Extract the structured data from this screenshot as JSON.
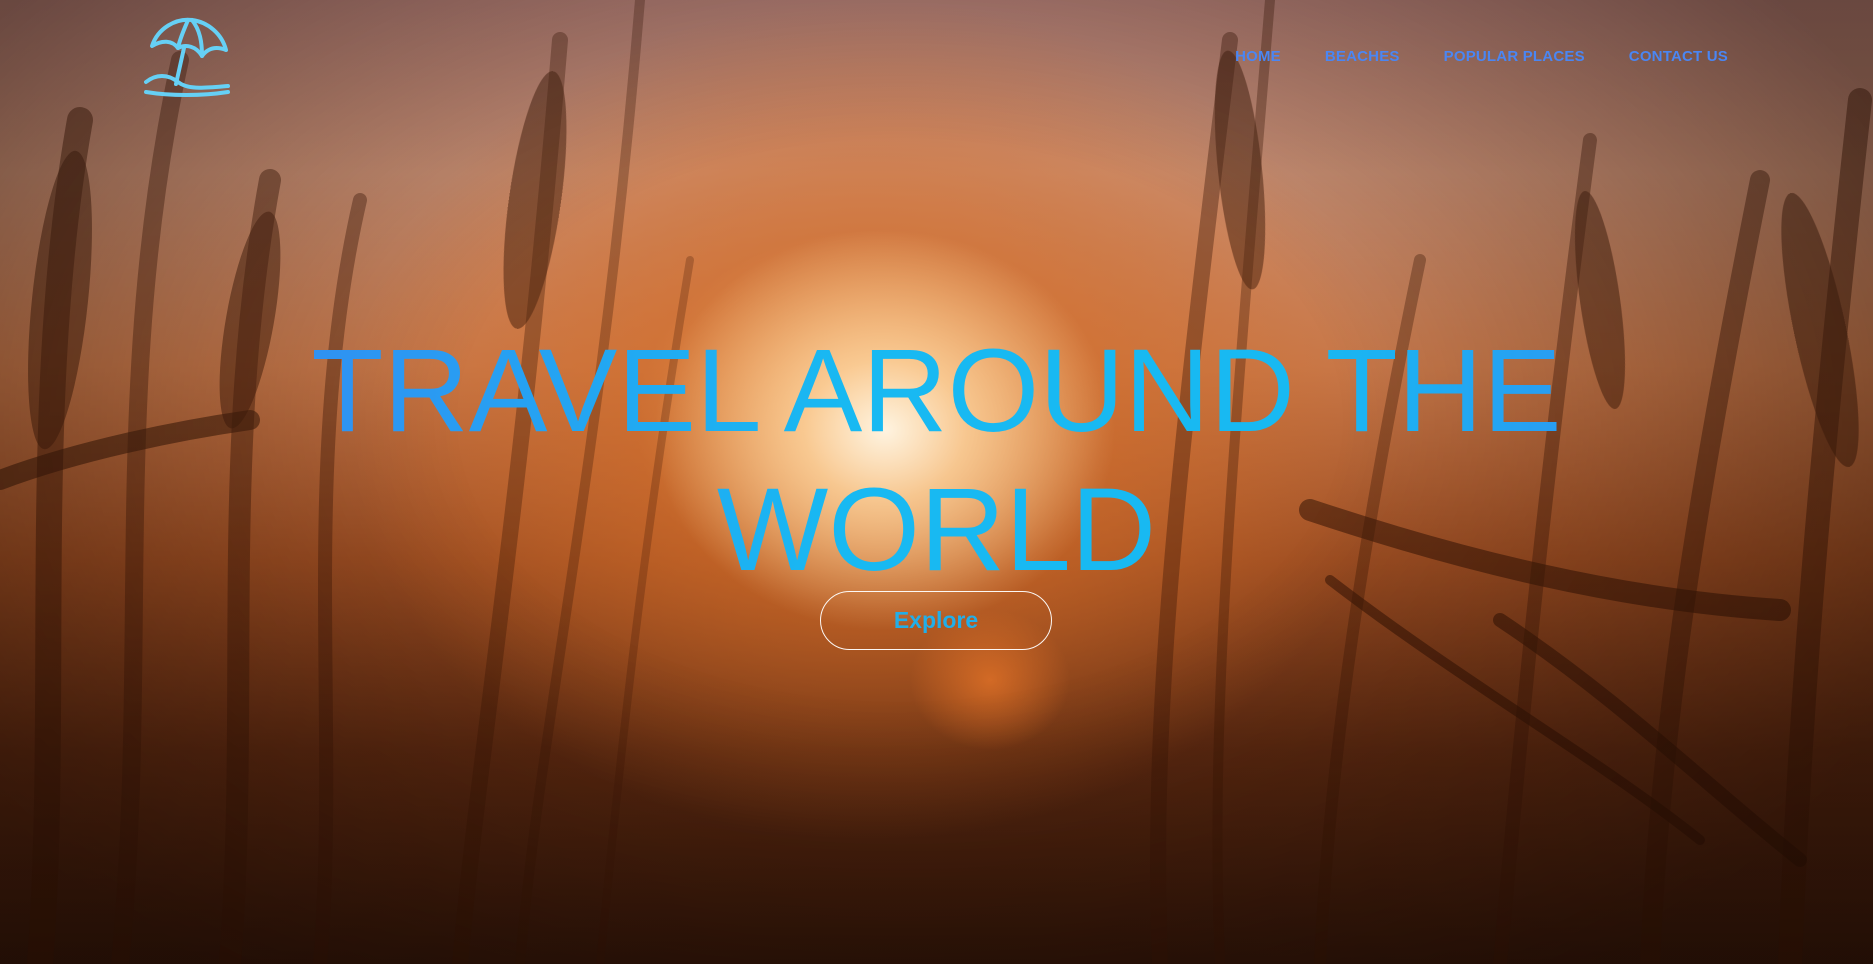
{
  "brand": {
    "logo_icon": "beach-umbrella-icon",
    "logo_color": "#66d0f5"
  },
  "nav": {
    "items": [
      {
        "label": "Home"
      },
      {
        "label": "Beaches"
      },
      {
        "label": "Popular Places"
      },
      {
        "label": "Contact Us"
      }
    ]
  },
  "hero": {
    "headline_line1": "Travel around the",
    "headline_line2": "world",
    "cta_label": "Explore",
    "background_subject": "wheat-field-sunset-photo"
  },
  "colors": {
    "nav_primary": "#4a86f3",
    "nav_secondary": "#27b7ef",
    "headline_gradient_start": "#3d7af2",
    "headline_gradient_mid": "#18b9f2",
    "cta_text": "#22aee8",
    "cta_border": "#ffffff"
  }
}
